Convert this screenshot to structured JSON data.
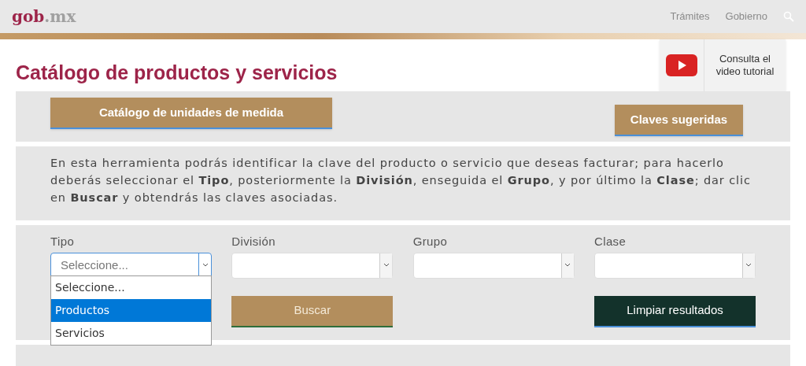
{
  "header": {
    "logo_main": "gob",
    "logo_suffix": ".mx",
    "nav": [
      "Trámites",
      "Gobierno"
    ]
  },
  "title": "Catálogo de productos y servicios",
  "video_button": {
    "label_line1": "Consulta el",
    "label_line2": "video tutorial"
  },
  "top_buttons": [
    "Catálogo de unidades de medida",
    "Claves sugeridas"
  ],
  "instructions": "En esta herramienta podrás identificar la clave del producto o servicio que deseas facturar; para hacerlo deberás seleccionar el **Tipo**, posteriormente la **División**, enseguida el **Grupo**, y por último la **Clase**; dar clic en **Buscar** y obtendrás las claves asociadas.",
  "filters": [
    {
      "label": "Tipo",
      "value": "Seleccione...",
      "expanded": true,
      "options": [
        {
          "label": "Seleccione...",
          "highlighted": false
        },
        {
          "label": "Productos",
          "highlighted": true
        },
        {
          "label": "Servicios",
          "highlighted": false
        }
      ]
    },
    {
      "label": "División",
      "expanded": false
    },
    {
      "label": "Grupo",
      "expanded": false
    },
    {
      "label": "Clase",
      "expanded": false
    }
  ],
  "search_button": "Buscar",
  "clear_button": "Limpiar resultados"
}
